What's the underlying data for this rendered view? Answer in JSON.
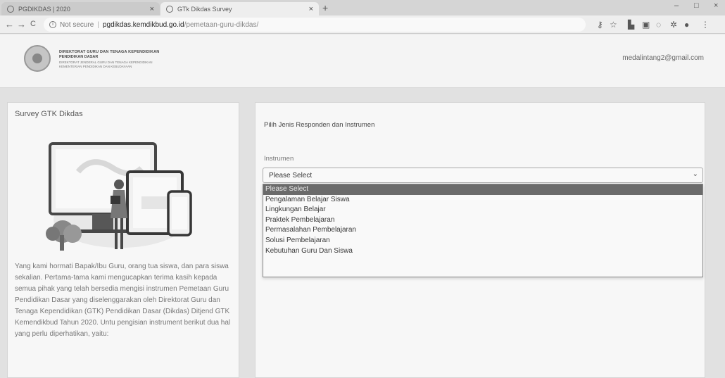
{
  "browser": {
    "tabs": [
      {
        "title": "PGDIKDAS | 2020",
        "active": false
      },
      {
        "title": "GTk Dikdas Survey",
        "active": true
      }
    ],
    "new_tab": "+",
    "nav": {
      "back": "←",
      "forward": "→",
      "reload": "C"
    },
    "address": {
      "security": "Not secure",
      "separator": "|",
      "host": "pgdikdas.kemdikbud.go.id",
      "path": "/pemetaan-guru-dikdas/"
    },
    "window_controls": {
      "minimize": "–",
      "maximize": "□",
      "close": "×"
    }
  },
  "site": {
    "org_line1": "DIREKTORAT GURU DAN TENAGA KEPENDIDIKAN",
    "org_line2": "PENDIDIKAN DASAR",
    "org_line3": "DIREKTORAT JENDERAL GURU DAN TENAGA KEPENDIDIKAN",
    "org_line4": "KEMENTERIAN PENDIDIKAN DAN KEBUDAYAAN",
    "user_email": "medalintang2@gmail.com"
  },
  "left_card": {
    "title": "Survey GTK Dikdas",
    "intro": "Yang kami hormati Bapak/Ibu Guru, orang tua siswa, dan para siswa sekalian. Pertama-tama kami mengucapkan terima kasih kepada semua pihak yang telah bersedia mengisi instrumen Pemetaan Guru Pendidikan Dasar yang diselenggarakan oleh Direktorat Guru dan Tenaga Kependidikan (GTK) Pendidikan Dasar (Dikdas) Ditjend GTK Kemendikbud Tahun 2020. Untu pengisian instrument berikut dua hal yang perlu diperhatikan, yaitu:"
  },
  "right_card": {
    "title": "Pilih Jenis Responden dan Instrumen",
    "field_label": "Instrumen",
    "select_value": "Please Select",
    "options": [
      "Please Select",
      "Pengalaman Belajar Siswa",
      "Lingkungan Belajar",
      "Praktek Pembelajaran",
      "Permasalahan Pembelajaran",
      "Solusi Pembelajaran",
      "Kebutuhan Guru Dan Siswa"
    ],
    "highlighted_option_index": 0
  }
}
